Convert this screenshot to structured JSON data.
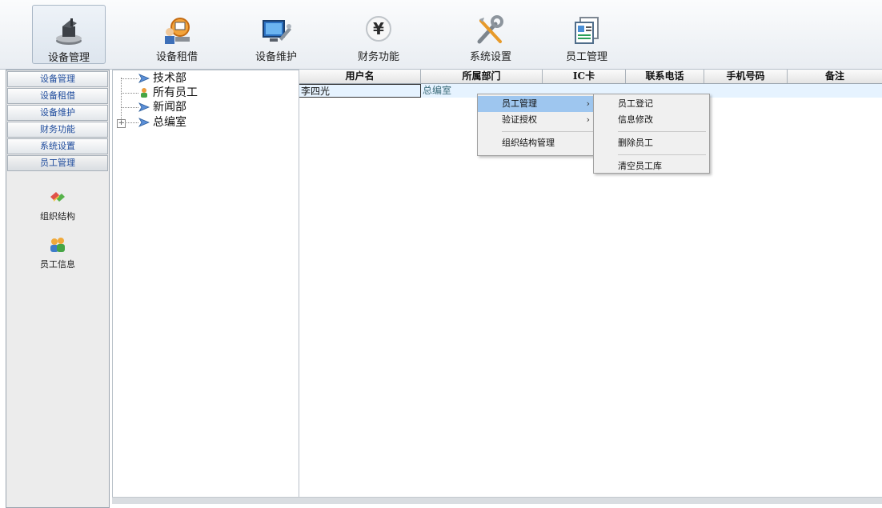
{
  "toolbar": {
    "items": [
      {
        "label": "设备管理",
        "icon": "device-management-icon"
      },
      {
        "label": "设备租借",
        "icon": "device-rental-icon"
      },
      {
        "label": "设备维护",
        "icon": "device-maintenance-icon"
      },
      {
        "label": "财务功能",
        "icon": "finance-icon"
      },
      {
        "label": "系统设置",
        "icon": "system-settings-icon"
      },
      {
        "label": "员工管理",
        "icon": "staff-management-icon"
      }
    ]
  },
  "leftnav": {
    "buttons": [
      "设备管理",
      "设备租借",
      "设备维护",
      "财务功能",
      "系统设置",
      "员工管理"
    ],
    "sub_items": [
      {
        "label": "组织结构",
        "icon": "org-structure-icon"
      },
      {
        "label": "员工信息",
        "icon": "staff-info-icon"
      }
    ]
  },
  "tree": {
    "nodes": [
      {
        "label": "技术部",
        "icon": "folder-arrow-icon"
      },
      {
        "label": "所有员工",
        "icon": "user-group-icon"
      },
      {
        "label": "新闻部",
        "icon": "folder-arrow-icon"
      },
      {
        "label": "总编室",
        "icon": "folder-arrow-icon"
      }
    ],
    "expander": "+"
  },
  "grid": {
    "columns": [
      "用户名",
      "所属部门",
      "IC卡",
      "联系电话",
      "手机号码",
      "备注"
    ],
    "rows": [
      {
        "username": "李四光",
        "department": "总编室",
        "ic_card": "",
        "phone": "",
        "mobile": "",
        "remark": ""
      }
    ]
  },
  "context_menu": {
    "main": [
      {
        "label": "员工管理",
        "arrow": "›"
      },
      {
        "label": "验证授权",
        "arrow": "›"
      },
      {
        "label": "组织结构管理",
        "arrow": ""
      }
    ],
    "submenu": [
      "员工登记",
      "信息修改",
      "删除员工",
      "清空员工库"
    ]
  },
  "colors": {
    "nav_text": "#1e4b9c",
    "menu_highlight": "#9ec6ef",
    "row_selected": "#e6f3ff"
  }
}
